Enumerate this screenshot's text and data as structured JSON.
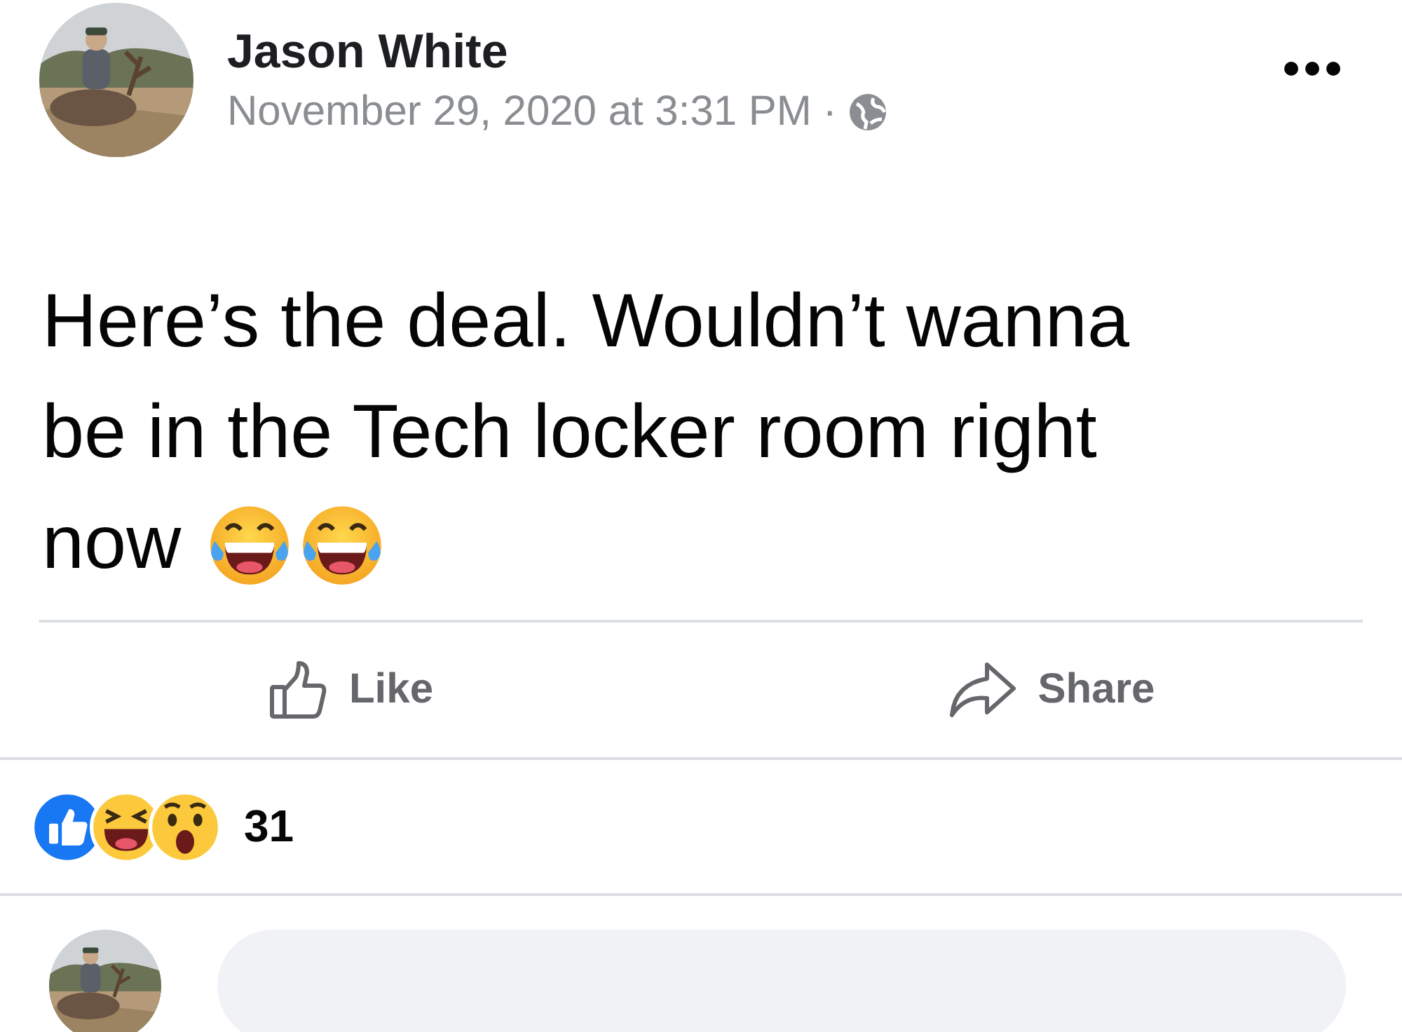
{
  "post": {
    "author": "Jason White",
    "timestamp": "November 29, 2020 at 3:31 PM",
    "separator": "·",
    "audience_icon": {
      "kind": "globe"
    },
    "text_lines": [
      "Here’s the deal. Wouldn’t wanna",
      "be in the Tech locker room right",
      "now"
    ],
    "emojis": [
      {
        "kind": "tears-of-joy"
      },
      {
        "kind": "tears-of-joy"
      }
    ]
  },
  "actions": [
    {
      "label": "Like",
      "kind": "like"
    },
    {
      "label": "Share",
      "kind": "share"
    }
  ],
  "reactions": {
    "types": [
      {
        "kind": "like"
      },
      {
        "kind": "haha"
      },
      {
        "kind": "wow"
      }
    ],
    "count": "31"
  }
}
